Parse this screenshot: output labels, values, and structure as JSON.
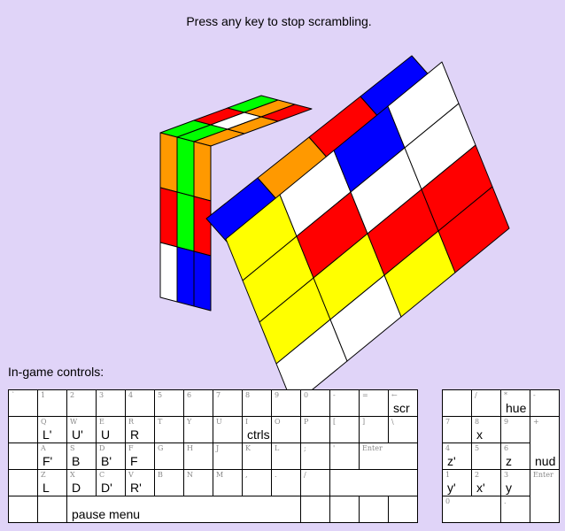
{
  "status": "Press any key to stop scrambling.",
  "controls_label": "In-game controls:",
  "colors": {
    "background": "#e0d4f8",
    "cube": {
      "G": "#00ff00",
      "O": "#ff9900",
      "R": "#ff0000",
      "W": "#ffffff",
      "Y": "#ffff00",
      "B": "#0000ff"
    }
  },
  "keyboard_rows": [
    [
      {
        "k": "`"
      },
      {
        "k": "1"
      },
      {
        "k": "2"
      },
      {
        "k": "3"
      },
      {
        "k": "4"
      },
      {
        "k": "5"
      },
      {
        "k": "6"
      },
      {
        "k": "7"
      },
      {
        "k": "8"
      },
      {
        "k": "9"
      },
      {
        "k": "0"
      },
      {
        "k": "-"
      },
      {
        "k": "="
      },
      {
        "k": "←",
        "a": "scr"
      }
    ],
    [
      {
        "k": ""
      },
      {
        "k": "Q",
        "a": "L'"
      },
      {
        "k": "W",
        "a": "U'"
      },
      {
        "k": "E",
        "a": "U"
      },
      {
        "k": "R",
        "a": "R"
      },
      {
        "k": "T"
      },
      {
        "k": "Y"
      },
      {
        "k": "U"
      },
      {
        "k": "I",
        "a": "ctrls"
      },
      {
        "k": "O"
      },
      {
        "k": "P"
      },
      {
        "k": "["
      },
      {
        "k": "]"
      },
      {
        "k": "\\"
      }
    ],
    [
      {
        "k": ""
      },
      {
        "k": "A",
        "a": "F'"
      },
      {
        "k": "S",
        "a": "B"
      },
      {
        "k": "D",
        "a": "B'"
      },
      {
        "k": "F",
        "a": "F"
      },
      {
        "k": "G"
      },
      {
        "k": "H"
      },
      {
        "k": "J"
      },
      {
        "k": "K"
      },
      {
        "k": "L"
      },
      {
        "k": ";"
      },
      {
        "k": "'"
      },
      {
        "k": "Enter"
      }
    ],
    [
      {
        "k": ""
      },
      {
        "k": "Z",
        "a": "L"
      },
      {
        "k": "X",
        "a": "D"
      },
      {
        "k": "C",
        "a": "D'"
      },
      {
        "k": "V",
        "a": "R'"
      },
      {
        "k": "B"
      },
      {
        "k": "N"
      },
      {
        "k": "M"
      },
      {
        "k": ","
      },
      {
        "k": "."
      },
      {
        "k": "/"
      },
      {
        "k": ""
      }
    ],
    [
      {
        "k": ""
      },
      {
        "k": ""
      },
      {
        "k": "",
        "a": "pause menu"
      },
      {
        "k": ""
      },
      {
        "k": ""
      },
      {
        "k": ""
      },
      {
        "k": ""
      }
    ]
  ],
  "numpad_keys": [
    {
      "k": ""
    },
    {
      "k": "/"
    },
    {
      "k": "*",
      "a": "hue"
    },
    {
      "k": "-"
    },
    {
      "k": "7"
    },
    {
      "k": "8",
      "a": "x"
    },
    {
      "k": "9"
    },
    {
      "k": "+",
      "a": "nud"
    },
    {
      "k": "4",
      "a": "z'"
    },
    {
      "k": "5"
    },
    {
      "k": "6",
      "a": "z"
    },
    {
      "k": "1",
      "a": "y'"
    },
    {
      "k": "2",
      "a": "x'"
    },
    {
      "k": "3",
      "a": "y"
    },
    {
      "k": "Enter"
    },
    {
      "k": "0"
    },
    {
      "k": "."
    }
  ]
}
